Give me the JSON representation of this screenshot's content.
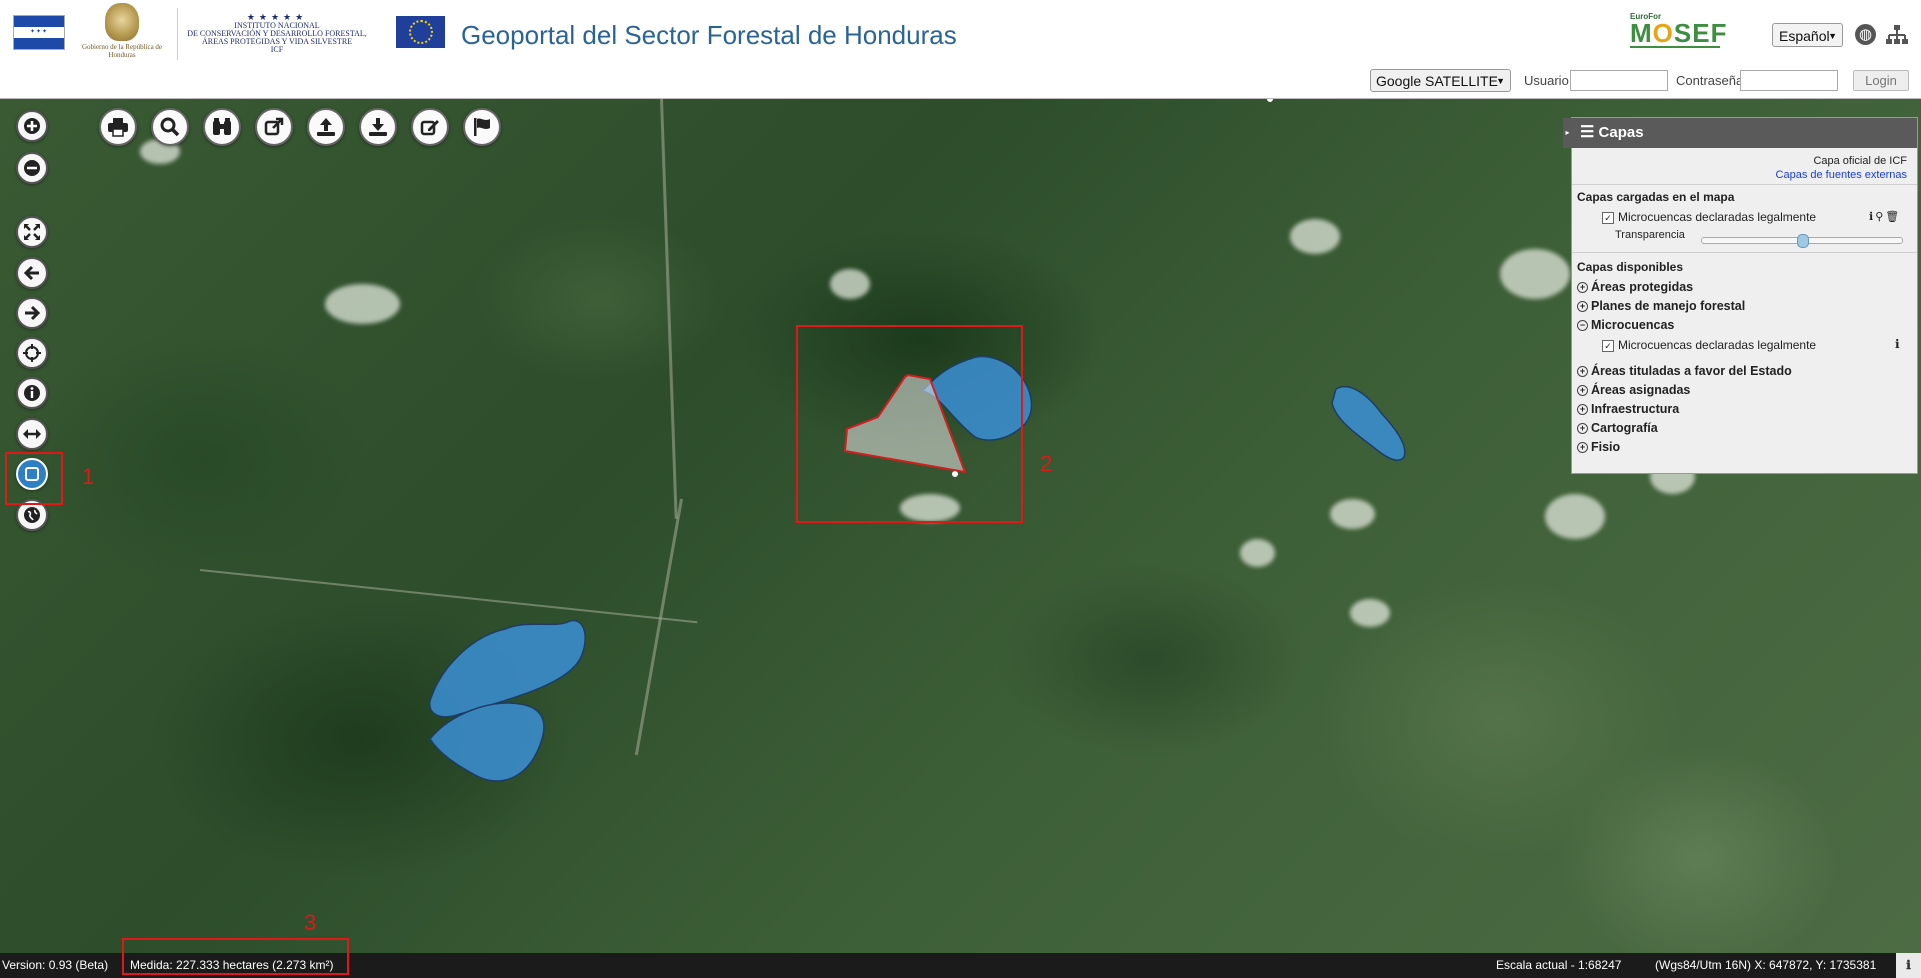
{
  "header": {
    "hn_gov_text": "Gobierno de la República de Honduras",
    "icf_stars": "★★★★★",
    "icf_lines": [
      "INSTITUTO NACIONAL",
      "DE CONSERVACIÓN Y DESARROLLO FORESTAL,",
      "ÁREAS PROTEGIDAS Y VIDA SILVESTRE",
      "ICF"
    ],
    "title": "Geoportal del Sector Forestal de Honduras",
    "partner_small": "EuroFor",
    "partner_big_a": "M",
    "partner_big_b": "O",
    "partner_big_c": "SEF",
    "language": "Español",
    "basemap": "Google SATELLITE",
    "user_label": "Usuario",
    "password_label": "Contraseña",
    "user_value": "",
    "password_value": "",
    "login_label": "Login"
  },
  "map": {
    "zoom_buttons": [
      "zoom-in",
      "zoom-out"
    ],
    "nav_buttons": [
      "full-extent",
      "previous-view",
      "next-view",
      "pan",
      "identify",
      "measure-distance",
      "measure-area",
      "coordinates"
    ],
    "active_tool": "measure-area",
    "toolbar": [
      "print",
      "search",
      "find",
      "share",
      "upload",
      "download",
      "edit",
      "bookmark"
    ],
    "annotations": [
      "1",
      "2",
      "3"
    ]
  },
  "layers_panel": {
    "title": "Capas",
    "official_link": "Capa oficial de ICF",
    "external_link": "Capas de fuentes externas",
    "loaded_heading": "Capas cargadas en el mapa",
    "loaded_layer": "Microcuencas declaradas legalmente",
    "loaded_layer_checked": true,
    "transparency_label": "Transparencia",
    "transparency_value": 0.5,
    "available_heading": "Capas disponibles",
    "groups": [
      {
        "label": "Áreas protegidas",
        "expanded": false
      },
      {
        "label": "Planes de manejo forestal",
        "expanded": false
      },
      {
        "label": "Microcuencas",
        "expanded": true
      },
      {
        "label": "Áreas tituladas a favor del Estado",
        "expanded": false
      },
      {
        "label": "Áreas asignadas",
        "expanded": false
      },
      {
        "label": "Infraestructura",
        "expanded": false
      },
      {
        "label": "Cartografía",
        "expanded": false
      },
      {
        "label": "Fisio",
        "expanded": false
      }
    ],
    "sublayer": "Microcuencas declaradas legalmente"
  },
  "status": {
    "version": "Version: 0.93 (Beta)",
    "measure": "Medida: 227.333 hectares (2.273 km²)",
    "scale": "Escala actual - 1:68247",
    "coords": "(Wgs84/Utm 16N) X: 647872, Y: 1735381"
  },
  "colors": {
    "title": "#2a6496",
    "microcuencas_fill": "#3b8fd6",
    "measure_polygon": "#d41e1e",
    "annotation": "#e01818",
    "active_tool": "#2f7fc6"
  }
}
